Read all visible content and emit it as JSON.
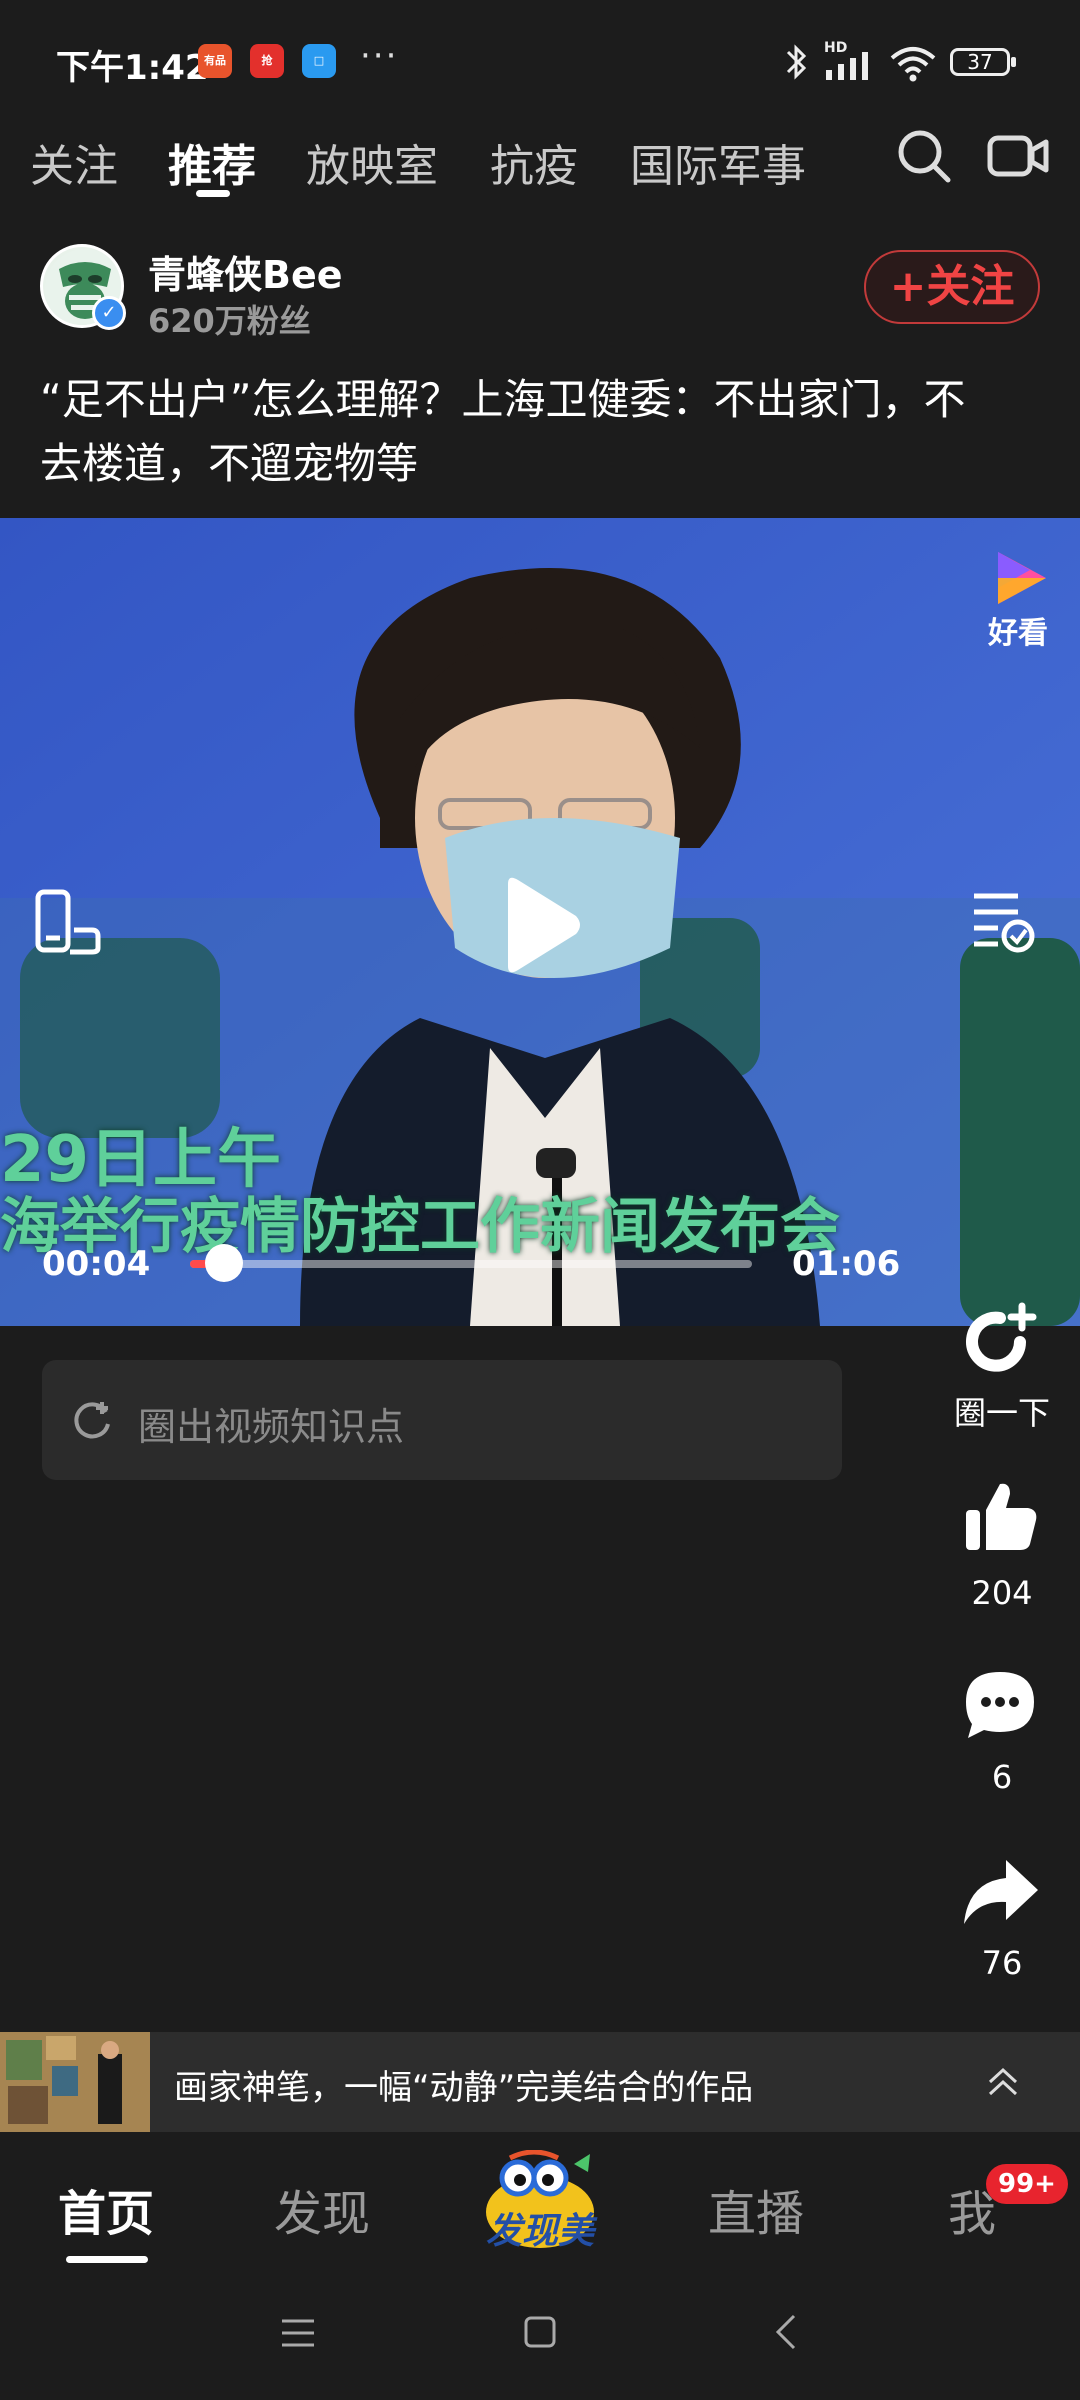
{
  "status_bar": {
    "time": "下午1:42",
    "battery": "37",
    "dots": "···",
    "hd_label": "HD"
  },
  "tabs": [
    {
      "label": "关注"
    },
    {
      "label": "推荐"
    },
    {
      "label": "放映室"
    },
    {
      "label": "抗疫"
    },
    {
      "label": "国际军事"
    }
  ],
  "author": {
    "name": "青蜂侠Bee",
    "fans": "620万粉丝",
    "follow_label": "+关注"
  },
  "headline": "“足不出户”怎么理解？上海卫健委：不出家门，不去楼道，不遛宠物等",
  "video": {
    "watermark": "好看",
    "caption_line1": "29日上午",
    "caption_line2": "海举行疫情防控工作新闻发布会",
    "current_time": "00:04",
    "duration": "01:06",
    "progress_fraction": 0.06
  },
  "knowledge_placeholder": "圈出视频知识点",
  "actions": {
    "circle_label": "圈一下",
    "likes": "204",
    "comments": "6",
    "shares": "76"
  },
  "recommendation": {
    "text": "画家神笔，一幅“动静”完美结合的作品"
  },
  "bottom_nav": {
    "home": "首页",
    "discover": "发现",
    "center_logo": "发现美",
    "live": "直播",
    "me": "我",
    "badge": "99+"
  },
  "colors": {
    "accent_red": "#f04444",
    "background": "#1c1c1c",
    "video_bg": "#3e63c8",
    "caption_green": "#5fd09a"
  }
}
